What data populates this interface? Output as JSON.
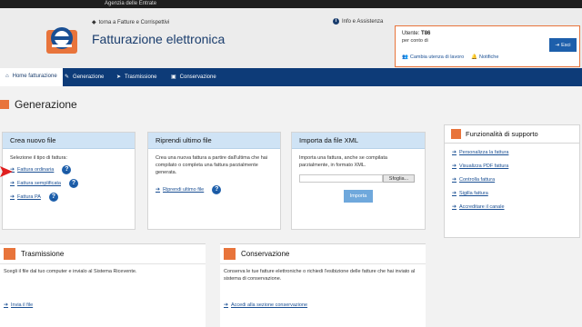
{
  "topbar": {
    "agency": "Agenzia delle Entrate"
  },
  "header": {
    "back_link": "torna a Fatture e Corrispettivi",
    "app_title": "Fatturazione elettronica",
    "info_link": "Info e Assistenza",
    "user": {
      "label": "Utente:",
      "code": "T86",
      "per_conto": "per conto di",
      "change_link": "Cambia utenza di lavoro",
      "notify_link": "Notifiche",
      "exit_label": "Esci"
    }
  },
  "nav": {
    "tabs": [
      {
        "label": "Home fatturazione",
        "icon": "home-icon"
      },
      {
        "label": "Generazione",
        "icon": "pencil-icon"
      },
      {
        "label": "Trasmissione",
        "icon": "send-icon"
      },
      {
        "label": "Conservazione",
        "icon": "archive-icon"
      }
    ]
  },
  "page": {
    "title": "Generazione"
  },
  "panels": {
    "crea": {
      "title": "Crea nuovo file",
      "intro": "Selezione il tipo di fattura:",
      "links": [
        "Fattura ordinaria",
        "Fattura semplificata",
        "Fattura PA"
      ]
    },
    "riprendi": {
      "title": "Riprendi ultimo file",
      "text": "Crea una nuova fattura a partire dall'ultima che hai compilato o completa una fattura parzialmente generata.",
      "link": "Riprendi ultimo file"
    },
    "importa": {
      "title": "Importa da file XML",
      "text": "Importa una fattura, anche se compilata parzialmente, in formato XML.",
      "browse_label": "Sfoglia...",
      "import_label": "Importa"
    }
  },
  "support": {
    "title": "Funzionalità di supporto",
    "links": [
      "Personalizza la fattura",
      "Visualizza PDF fattura",
      "Controlla fattura",
      "Sigilla fattura",
      "Accreditare il canale"
    ]
  },
  "trasmissione": {
    "title": "Trasmissione",
    "text": "Scegli il file dal tuo computer e invialo al Sistema Ricevente.",
    "link": "Invia il file"
  },
  "conservazione": {
    "title": "Conservazione",
    "text": "Conserva le tue fatture elettroniche o richiedi l'esibizione delle fatture che hai inviato al sistema di conservazione.",
    "link": "Accedi alla sezione conservazione"
  },
  "colors": {
    "accent": "#e8743b",
    "nav": "#0d3b78",
    "panel_header": "#cfe3f5",
    "link": "#1a4f93"
  }
}
